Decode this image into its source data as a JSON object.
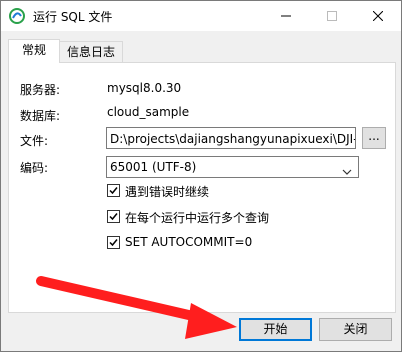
{
  "window": {
    "title": "运行 SQL 文件"
  },
  "tabs": [
    {
      "label": "常规",
      "active": true
    },
    {
      "label": "信息日志",
      "active": false
    }
  ],
  "fields": {
    "server_label": "服务器:",
    "server_value": "mysql8.0.30",
    "database_label": "数据库:",
    "database_value": "cloud_sample",
    "file_label": "文件:",
    "file_value": "D:\\projects\\dajiangshangyunapixuexi\\DJI-C",
    "browse_label": "...",
    "encoding_label": "编码:",
    "encoding_value": "65001 (UTF-8)"
  },
  "options": [
    {
      "label": "遇到错误时继续",
      "checked": true
    },
    {
      "label": "在每个运行中运行多个查询",
      "checked": true
    },
    {
      "label": "SET AUTOCOMMIT=0",
      "checked": true
    }
  ],
  "buttons": {
    "start": "开始",
    "close": "关闭"
  },
  "colors": {
    "accent": "#0078d7",
    "annotation_arrow": "#ff1e1e"
  }
}
